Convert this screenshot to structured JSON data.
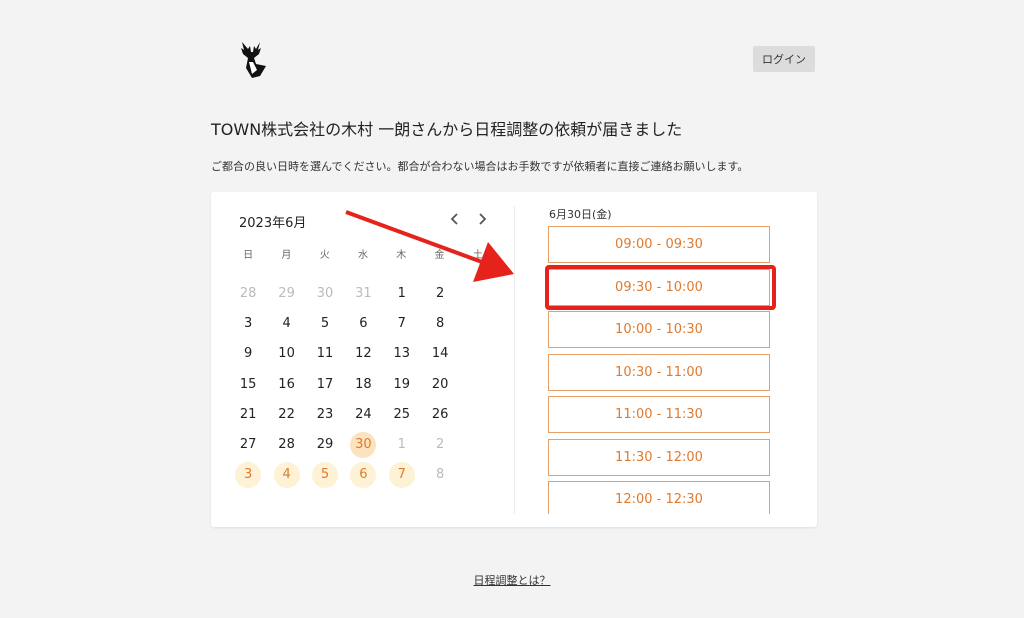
{
  "header": {
    "logo_icon": "deer-head-icon",
    "login_label": "ログイン"
  },
  "title": "TOWN株式会社の木村 一朗さんから日程調整の依頼が届きました",
  "subtitle": "ご都合の良い日時を選んでください。都合が合わない場合はお手数ですが依頼者に直接ご連絡お願いします。",
  "calendar": {
    "month_label": "2023年6月",
    "prev_icon": "chevron-left-icon",
    "next_icon": "chevron-right-icon",
    "weekdays": [
      "日",
      "月",
      "火",
      "水",
      "木",
      "金",
      "土"
    ],
    "days": [
      {
        "label": "28",
        "state": "muted"
      },
      {
        "label": "29",
        "state": "muted"
      },
      {
        "label": "30",
        "state": "muted"
      },
      {
        "label": "31",
        "state": "muted"
      },
      {
        "label": "1",
        "state": "normal"
      },
      {
        "label": "2",
        "state": "normal"
      },
      {
        "label": "3",
        "state": "normal"
      },
      {
        "label": "4",
        "state": "normal"
      },
      {
        "label": "5",
        "state": "normal"
      },
      {
        "label": "6",
        "state": "normal"
      },
      {
        "label": "7",
        "state": "normal"
      },
      {
        "label": "8",
        "state": "normal"
      },
      {
        "label": "9",
        "state": "normal"
      },
      {
        "label": "10",
        "state": "normal"
      },
      {
        "label": "11",
        "state": "normal"
      },
      {
        "label": "12",
        "state": "normal"
      },
      {
        "label": "13",
        "state": "normal"
      },
      {
        "label": "14",
        "state": "normal"
      },
      {
        "label": "15",
        "state": "normal"
      },
      {
        "label": "16",
        "state": "normal"
      },
      {
        "label": "17",
        "state": "normal"
      },
      {
        "label": "18",
        "state": "normal"
      },
      {
        "label": "19",
        "state": "normal"
      },
      {
        "label": "20",
        "state": "normal"
      },
      {
        "label": "21",
        "state": "normal"
      },
      {
        "label": "22",
        "state": "normal"
      },
      {
        "label": "23",
        "state": "normal"
      },
      {
        "label": "24",
        "state": "normal"
      },
      {
        "label": "25",
        "state": "normal"
      },
      {
        "label": "26",
        "state": "normal"
      },
      {
        "label": "27",
        "state": "normal"
      },
      {
        "label": "28",
        "state": "normal"
      },
      {
        "label": "29",
        "state": "normal"
      },
      {
        "label": "30",
        "state": "selected"
      },
      {
        "label": "1",
        "state": "muted"
      },
      {
        "label": "2",
        "state": "muted"
      },
      {
        "label": "3",
        "state": "avail"
      },
      {
        "label": "4",
        "state": "avail"
      },
      {
        "label": "5",
        "state": "avail"
      },
      {
        "label": "6",
        "state": "avail"
      },
      {
        "label": "7",
        "state": "avail"
      },
      {
        "label": "8",
        "state": "muted"
      }
    ]
  },
  "schedule": {
    "date_heading": "6月30日(金)",
    "slots": [
      "09:00 - 09:30",
      "09:30 - 10:00",
      "10:00 - 10:30",
      "10:30 - 11:00",
      "11:00 - 11:30",
      "11:30 - 12:00",
      "12:00 - 12:30"
    ]
  },
  "annotations": {
    "arrow_color": "#e5231b",
    "highlight_color": "#e5231b"
  },
  "colors": {
    "accent": "#e07a2d",
    "available_day_bg": "#fdf1d6"
  },
  "footer": {
    "link_label": "日程調整とは？"
  }
}
